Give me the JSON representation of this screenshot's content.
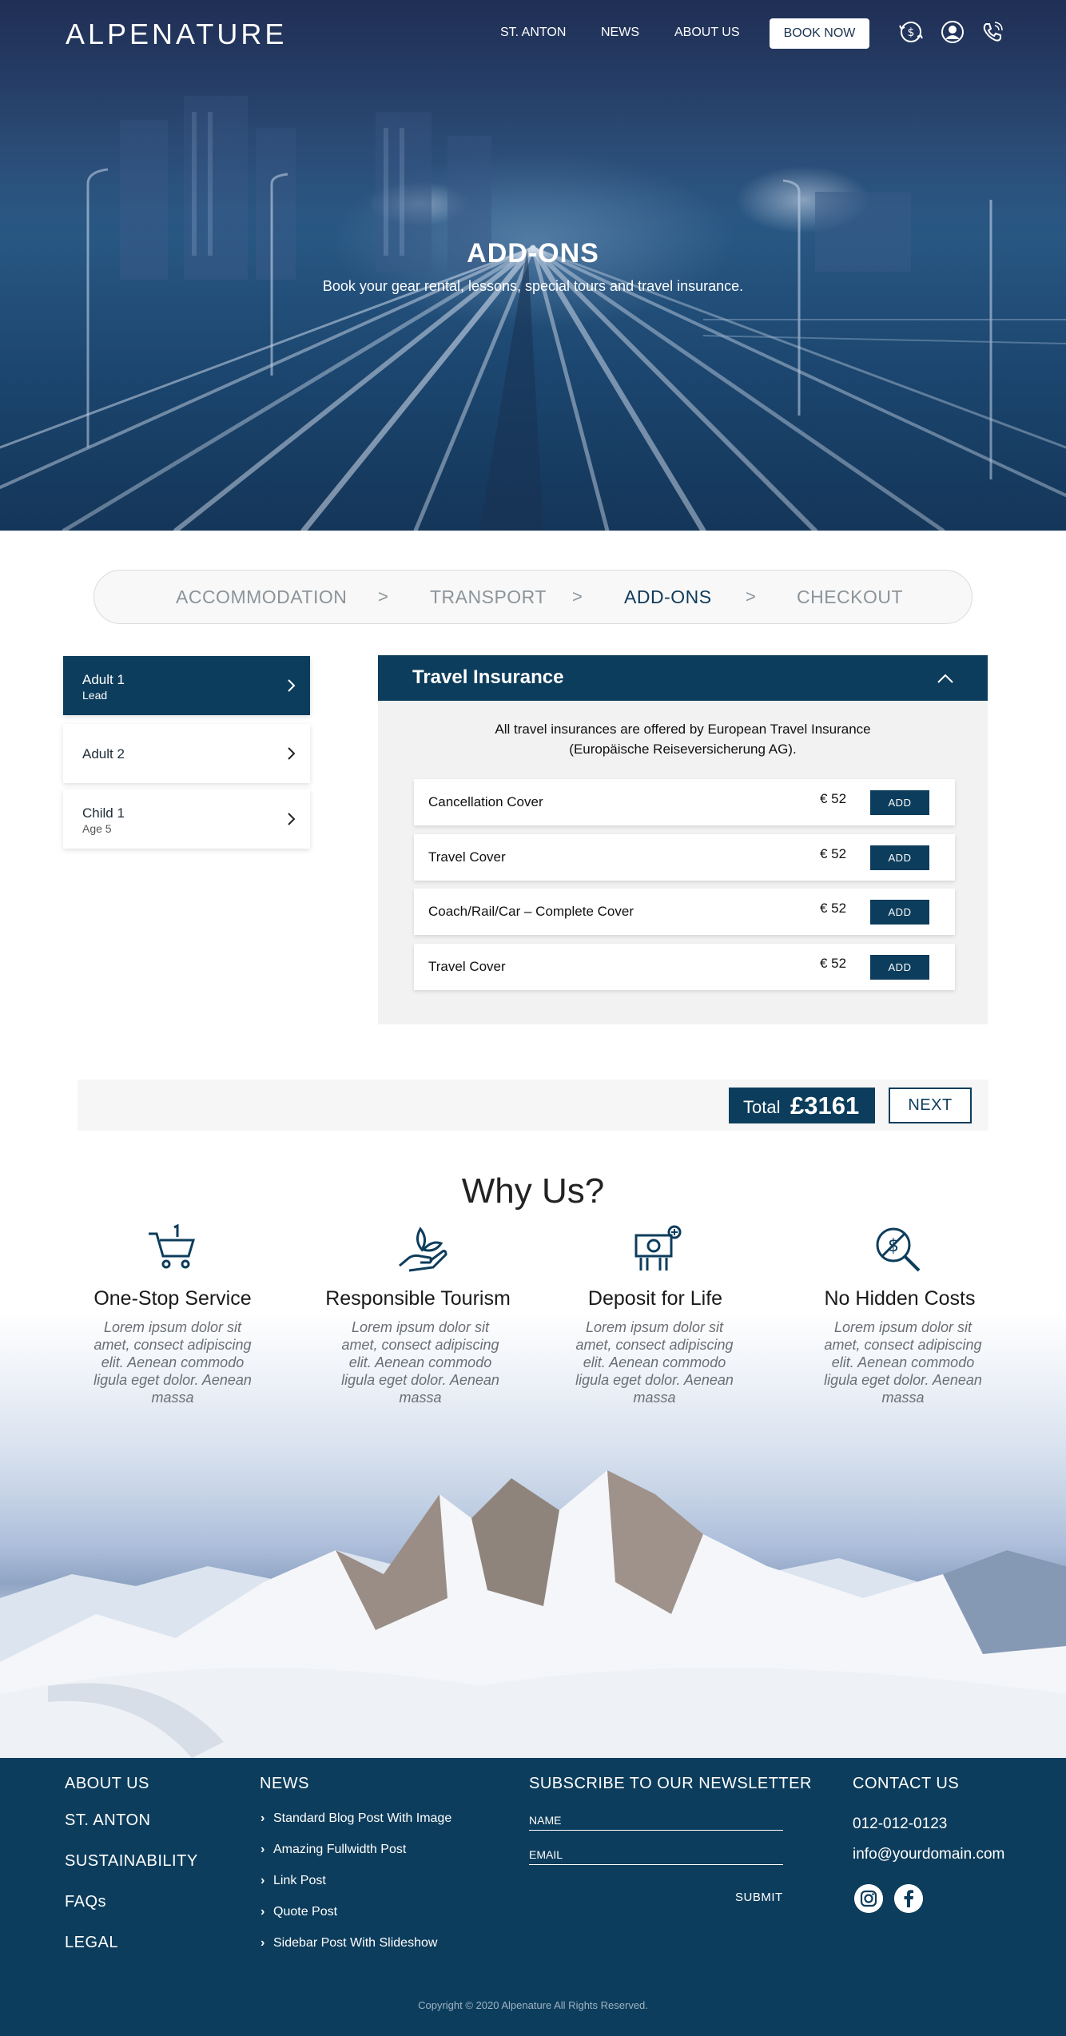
{
  "header": {
    "logo": "ALPENATURE",
    "nav": [
      "ST. ANTON",
      "NEWS",
      "ABOUT US"
    ],
    "book_label": "BOOK NOW",
    "icons": [
      "currency-exchange-icon",
      "user-icon",
      "phone-icon"
    ]
  },
  "hero": {
    "title": "ADD-ONS",
    "subtitle": "Book your gear rental, lessons, special tours and travel insurance."
  },
  "steps": {
    "items": [
      "ACCOMMODATION",
      "TRANSPORT",
      "ADD-ONS",
      "CHECKOUT"
    ],
    "separator": ">",
    "active": "ADD-ONS"
  },
  "travellers": [
    {
      "name": "Adult 1",
      "sub": "Lead",
      "active": true
    },
    {
      "name": "Adult 2",
      "sub": "",
      "active": false
    },
    {
      "name": "Child 1",
      "sub": "Age 5",
      "active": false
    }
  ],
  "insurance": {
    "title": "Travel Insurance",
    "note_line1": "All travel insurances are offered by European Travel Insurance",
    "note_line2": "(Europäische Reiseversicherung AG).",
    "add_label": "ADD",
    "rows": [
      {
        "label": "Cancellation Cover",
        "price": "€ 52"
      },
      {
        "label": "Travel Cover",
        "price": "€ 52"
      },
      {
        "label": "Coach/Rail/Car – Complete Cover",
        "price": "€ 52"
      },
      {
        "label": "Travel Cover",
        "price": "€ 52"
      }
    ]
  },
  "total": {
    "label": "Total",
    "value": "£3161",
    "next_label": "NEXT"
  },
  "why": {
    "title": "Why Us?",
    "items": [
      {
        "title": "One-Stop Service",
        "icon": "cart-icon",
        "text": "Lorem ipsum dolor sit amet, consect adipiscing elit. Aenean commodo ligula eget dolor. Aenean massa"
      },
      {
        "title": "Responsible Tourism",
        "icon": "hand-leaf-icon",
        "text": "Lorem ipsum dolor sit amet, consect adipiscing elit. Aenean commodo ligula eget dolor. Aenean massa"
      },
      {
        "title": "Deposit for Life",
        "icon": "money-icon",
        "text": "Lorem ipsum dolor sit amet, consect adipiscing elit. Aenean commodo ligula eget dolor. Aenean massa"
      },
      {
        "title": "No Hidden Costs",
        "icon": "no-cost-search-icon",
        "text": "Lorem ipsum dolor sit amet, consect adipiscing elit. Aenean commodo ligula eget dolor. Aenean massa"
      }
    ]
  },
  "footer": {
    "links": [
      "ABOUT US",
      "ST. ANTON",
      "SUSTAINABILITY",
      "FAQs",
      "LEGAL"
    ],
    "news_heading": "NEWS",
    "news": [
      "Standard Blog Post With Image",
      "Amazing Fullwidth Post",
      "Link Post",
      "Quote Post",
      "Sidebar Post With Slideshow"
    ],
    "newsletter_heading": "SUBSCRIBE TO OUR NEWSLETTER",
    "name_label": "NAME",
    "email_label": "EMAIL",
    "submit_label": "SUBMIT",
    "contact_heading": "CONTACT US",
    "phone": "012-012-0123",
    "email": "info@yourdomain.com",
    "social": [
      "instagram-icon",
      "facebook-icon"
    ],
    "copyright": "Copyright © 2020  Alpenature  All Rights Reserved."
  },
  "colors": {
    "primary": "#0d3d5c",
    "panel_bg": "#f2f2f2",
    "muted": "#8c949a"
  }
}
